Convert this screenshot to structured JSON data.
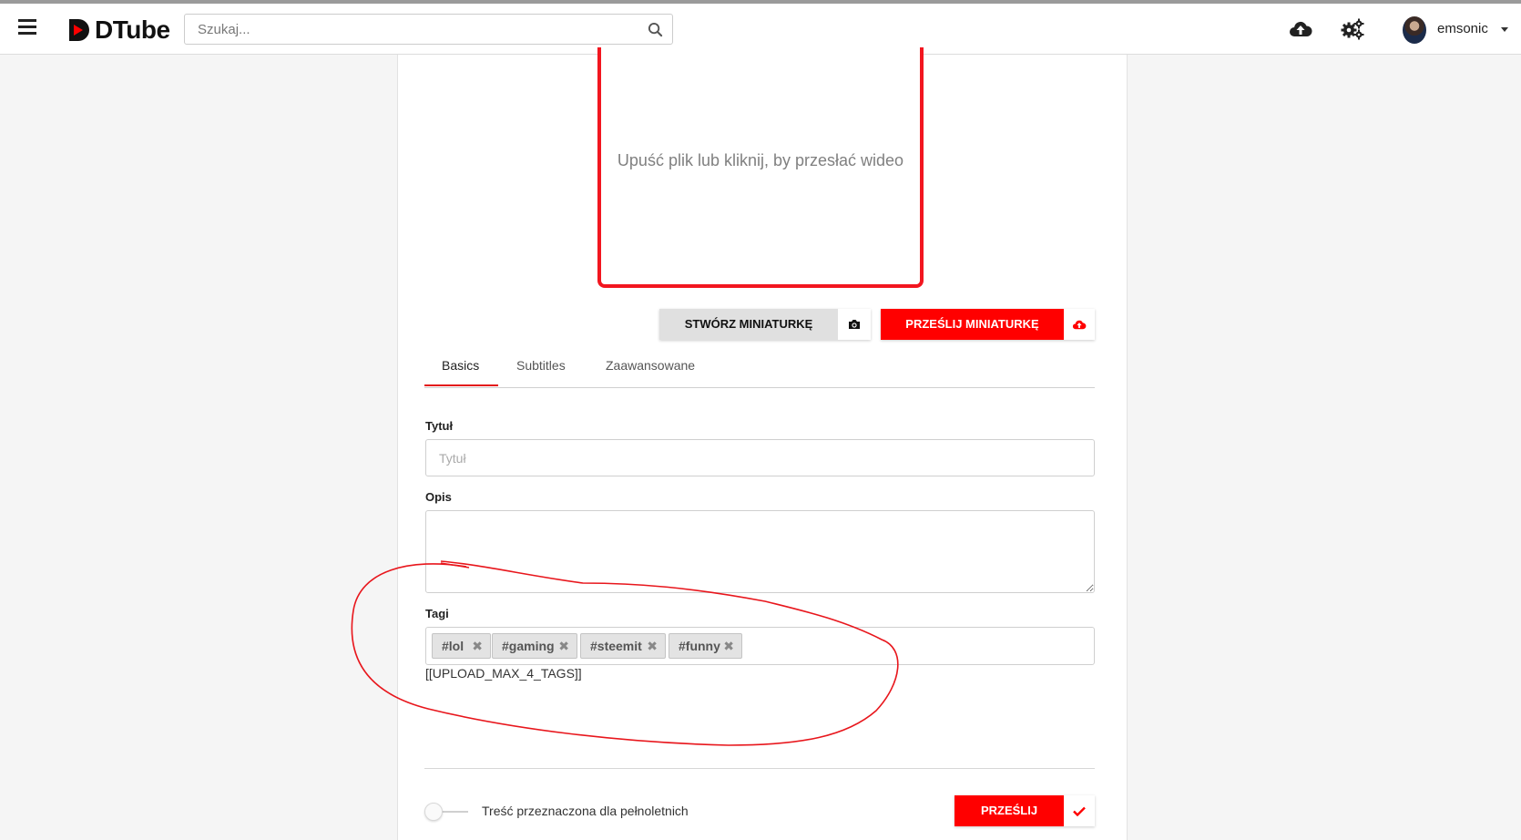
{
  "header": {
    "logo_text": "DTube",
    "search_placeholder": "Szukaj...",
    "username": "emsonic"
  },
  "upload": {
    "dropzone_text": "Upuść plik lub kliknij, by przesłać wideo",
    "create_thumbnail_label": "STWÓRZ MINIATURKĘ",
    "upload_thumbnail_label": "PRZEŚLIJ MINIATURKĘ"
  },
  "tabs": [
    {
      "label": "Basics",
      "active": true
    },
    {
      "label": "Subtitles",
      "active": false
    },
    {
      "label": "Zaawansowane",
      "active": false
    }
  ],
  "form": {
    "title_label": "Tytuł",
    "title_placeholder": "Tytuł",
    "description_label": "Opis",
    "tags_label": "Tagi",
    "tags": [
      "#lol",
      "#gaming",
      "#steemit",
      "#funny"
    ],
    "tag_hint": "[[UPLOAD_MAX_4_TAGS]]",
    "adult_label": "Treść przeznaczona dla pełnoletnich",
    "adult_checked": false,
    "submit_label": "PRZEŚLIJ"
  },
  "colors": {
    "accent": "#ff0000",
    "annotation": "#e8161c"
  },
  "icons": [
    "menu-icon",
    "search-icon",
    "cloud-upload-icon",
    "gears-icon",
    "camera-icon",
    "check-icon",
    "close-icon"
  ]
}
